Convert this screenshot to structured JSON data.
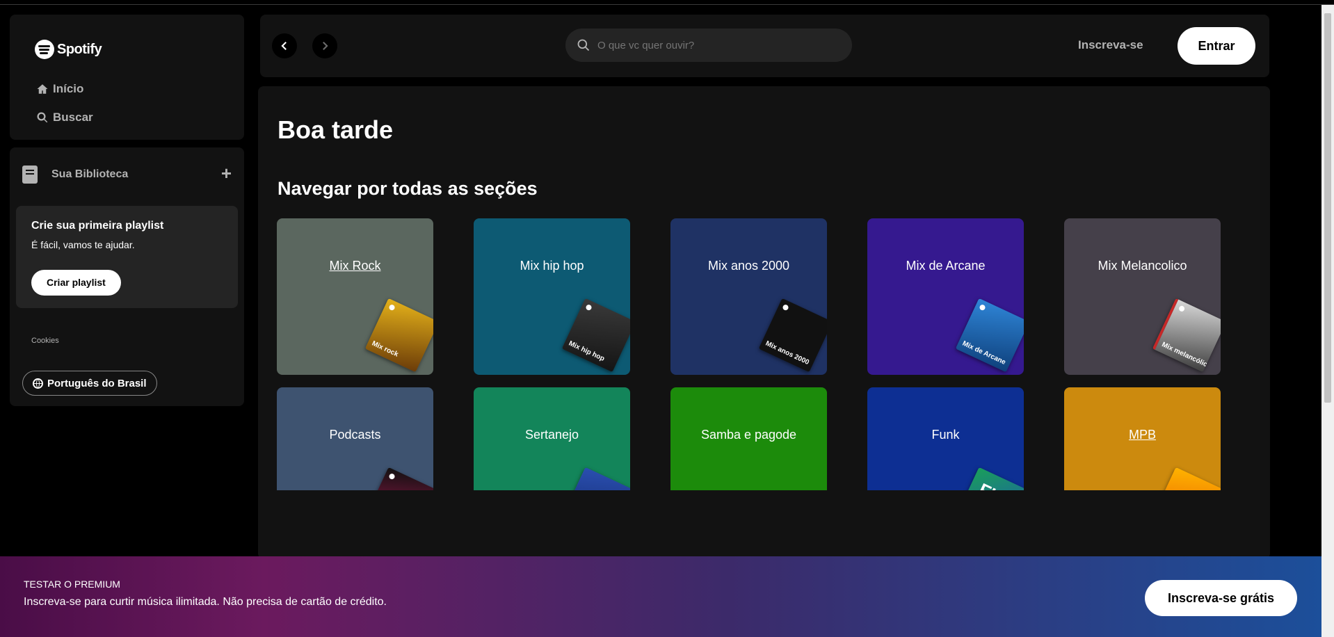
{
  "sidebar": {
    "logo_text": "Spotify",
    "nav": [
      {
        "label": "Início",
        "icon": "home-icon"
      },
      {
        "label": "Buscar",
        "icon": "search-icon"
      }
    ],
    "library": {
      "title": "Sua Biblioteca",
      "create_card": {
        "title": "Crie sua primeira playlist",
        "subtitle": "É fácil, vamos te ajudar.",
        "button": "Criar playlist"
      },
      "cookies": "Cookies",
      "language": "Português do Brasil"
    }
  },
  "topbar": {
    "search_placeholder": "O que vc quer ouvir?",
    "signup": "Inscreva-se",
    "login": "Entrar"
  },
  "main": {
    "greeting": "Boa tarde",
    "section_title": "Navegar por todas as seções",
    "cards": [
      {
        "label": "Mix Rock",
        "color": "#5b675f",
        "art_text": "Mix rock",
        "art_color": "#b8860b"
      },
      {
        "label": "Mix hip hop",
        "color": "#0d5a73",
        "art_text": "Mix hip hop",
        "art_color": "#2a2a2a"
      },
      {
        "label": "Mix anos 2000",
        "color": "#1f3264",
        "art_text": "Mix anos 2000",
        "art_color": "#111111"
      },
      {
        "label": "Mix de Arcane",
        "color": "#35198f",
        "art_text": "Mix de Arcane",
        "art_color": "#1f6fc1"
      },
      {
        "label": "Mix Melancolico",
        "color": "#45404a",
        "art_text": "Mix melancólico",
        "art_color": "#6b6b6b"
      },
      {
        "label": "Podcasts",
        "color": "#3e5370",
        "art_text": "",
        "art_color": "#c2185b"
      },
      {
        "label": "Sertanejo",
        "color": "#13855a",
        "art_text": "",
        "art_color": "#1d3a8a"
      },
      {
        "label": "Samba e pagode",
        "color": "#1c8b0b",
        "art_text": "",
        "art_color": "#1c8b0b"
      },
      {
        "label": "Funk",
        "color": "#0d2f93",
        "art_text": "FUN",
        "art_color": "#1a9e5a"
      },
      {
        "label": "MPB",
        "color": "#cc8a0e",
        "art_text": "",
        "art_color": "#e8a000"
      }
    ]
  },
  "banner": {
    "title": "TESTAR O PREMIUM",
    "subtitle": "Inscreva-se para curtir música ilimitada. Não precisa de cartão de crédito.",
    "button": "Inscreva-se grátis"
  }
}
